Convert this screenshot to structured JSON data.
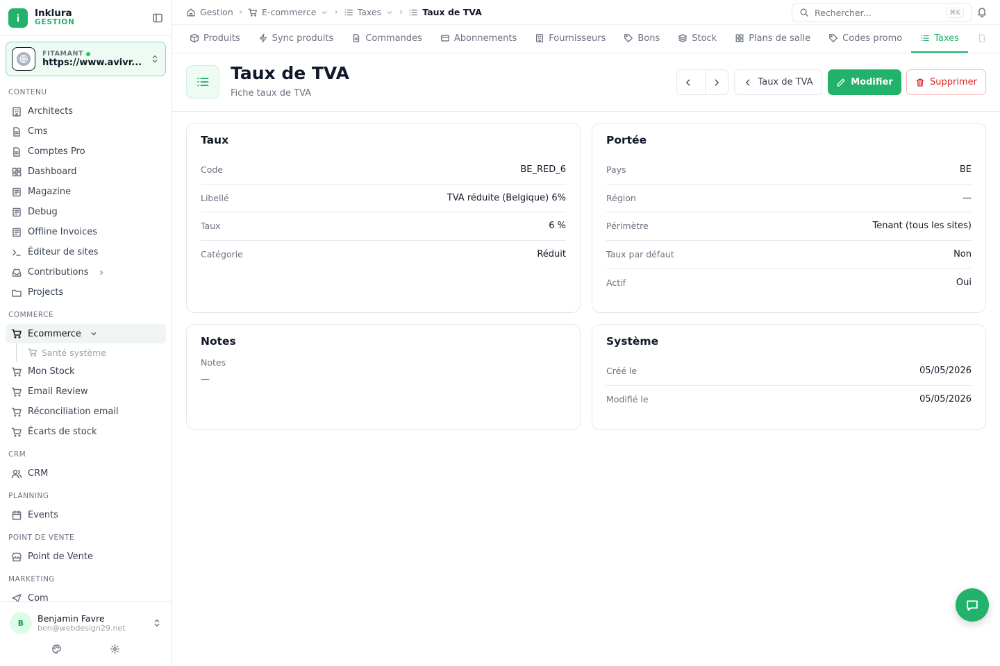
{
  "brand": {
    "name": "Inklura",
    "sub": "GESTION"
  },
  "site": {
    "label": "FITAMANT",
    "url": "https://www.avivr..."
  },
  "nav": {
    "sections": [
      {
        "title": "CONTENU",
        "items": [
          "Architects",
          "Cms",
          "Comptes Pro",
          "Dashboard",
          "Magazine",
          "Debug",
          "Offline Invoices",
          "Éditeur de sites",
          "Contributions",
          "Projects"
        ]
      },
      {
        "title": "COMMERCE",
        "items": [
          "Ecommerce",
          "Santé système",
          "Mon Stock",
          "Email Review",
          "Réconciliation email",
          "Écarts de stock"
        ]
      },
      {
        "title": "CRM",
        "items": [
          "CRM"
        ]
      },
      {
        "title": "PLANNING",
        "items": [
          "Events"
        ]
      },
      {
        "title": "POINT DE VENTE",
        "items": [
          "Point de Vente"
        ]
      },
      {
        "title": "MARKETING",
        "items": [
          "Com"
        ]
      }
    ]
  },
  "user": {
    "name": "Benjamin Favre",
    "email": "ben@webdesign29.net",
    "initial": "B"
  },
  "breadcrumb": [
    "Gestion",
    "E-commerce",
    "Taxes",
    "Taux de TVA"
  ],
  "search": {
    "placeholder": "Rechercher...",
    "shortcut": "⌘K"
  },
  "tabs": [
    "Produits",
    "Sync produits",
    "Commandes",
    "Abonnements",
    "Fournisseurs",
    "Bons",
    "Stock",
    "Plans de salle",
    "Codes promo",
    "Taxes"
  ],
  "active_tab": "Taxes",
  "page": {
    "title": "Taux de TVA",
    "subtitle": "Fiche taux de TVA",
    "back_label": "Taux de TVA",
    "edit_label": "Modifier",
    "delete_label": "Supprimer"
  },
  "cards": {
    "taux": {
      "title": "Taux",
      "rows": [
        {
          "label": "Code",
          "value": "BE_RED_6"
        },
        {
          "label": "Libellé",
          "value": "TVA réduite (Belgique) 6%"
        },
        {
          "label": "Taux",
          "value": "6 %"
        },
        {
          "label": "Catégorie",
          "value": "Réduit"
        }
      ]
    },
    "portee": {
      "title": "Portée",
      "rows": [
        {
          "label": "Pays",
          "value": "BE"
        },
        {
          "label": "Région",
          "value": "—"
        },
        {
          "label": "Périmètre",
          "value": "Tenant (tous les sites)"
        },
        {
          "label": "Taux par défaut",
          "value": "Non"
        },
        {
          "label": "Actif",
          "value": "Oui"
        }
      ]
    },
    "notes": {
      "title": "Notes",
      "label": "Notes",
      "value": "—"
    },
    "systeme": {
      "title": "Système",
      "rows": [
        {
          "label": "Créé le",
          "value": "05/05/2026"
        },
        {
          "label": "Modifié le",
          "value": "05/05/2026"
        }
      ]
    }
  },
  "colors": {
    "accent": "#22b26b",
    "danger": "#dc2626",
    "border": "#e5e7eb"
  }
}
